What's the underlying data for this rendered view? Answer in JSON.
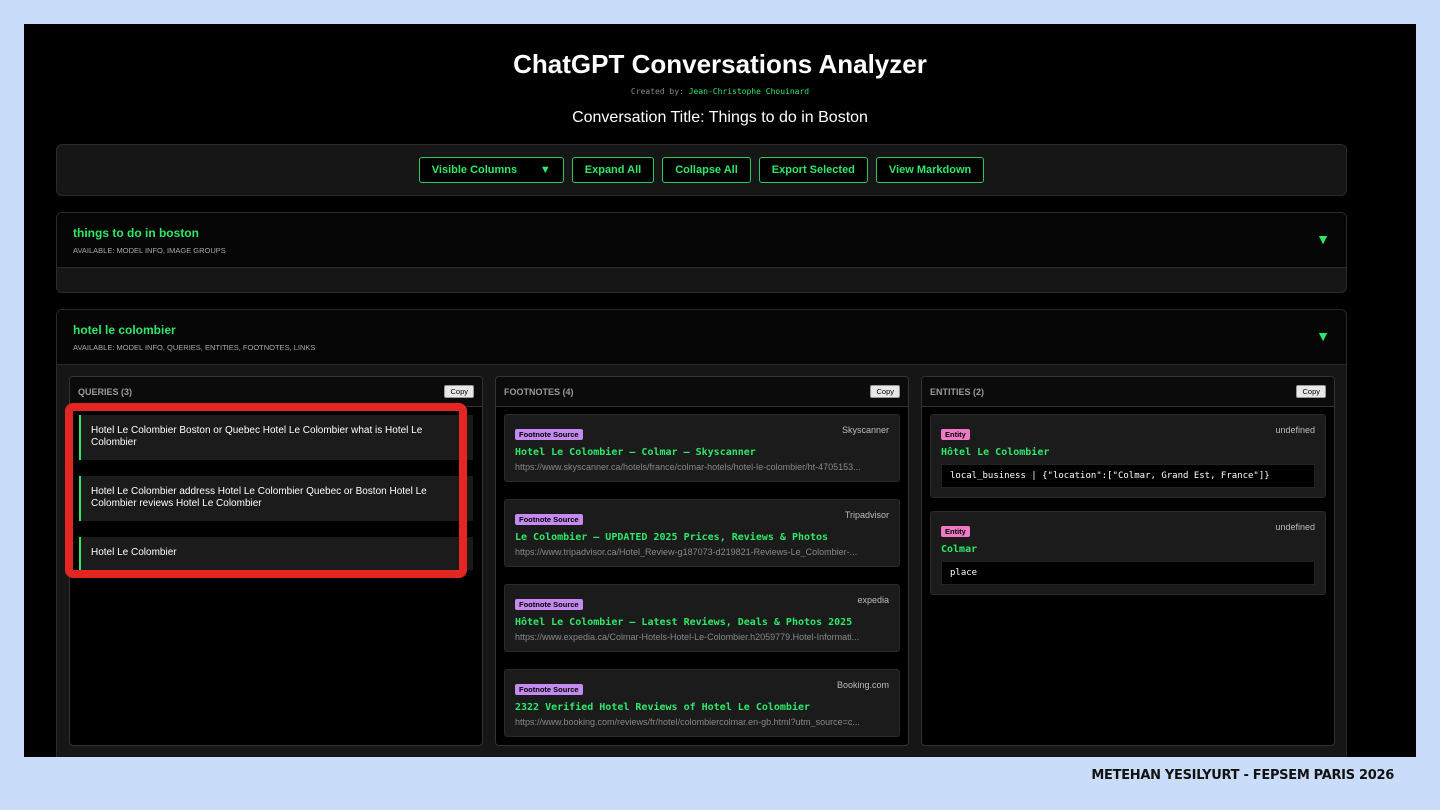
{
  "app": {
    "title": "ChatGPT Conversations Analyzer",
    "created_label": "Created by:",
    "author": "Jean-Christophe Chouinard",
    "conversation_title": "Conversation Title: Things to do in Boston"
  },
  "toolbar": {
    "visible_columns": "Visible Columns",
    "dropdown_arrow": "▼",
    "expand_all": "Expand All",
    "collapse_all": "Collapse All",
    "export_selected": "Export Selected",
    "view_markdown": "View Markdown"
  },
  "panels": [
    {
      "name": "things to do in boston",
      "available": "AVAILABLE: MODEL INFO, IMAGE GROUPS",
      "toggle": "▼"
    },
    {
      "name": "hotel le colombier",
      "available": "AVAILABLE: MODEL INFO, QUERIES, ENTITIES, FOOTNOTES, LINKS",
      "toggle": "▼"
    }
  ],
  "queries": {
    "title": "QUERIES (3)",
    "copy": "Copy",
    "items": [
      "Hotel Le Colombier Boston or Quebec Hotel Le Colombier what is Hotel Le Colombier",
      "Hotel Le Colombier address Hotel Le Colombier Quebec or Boston Hotel Le Colombier reviews Hotel Le Colombier",
      "Hotel Le Colombier"
    ]
  },
  "footnotes": {
    "title": "FOOTNOTES (4)",
    "copy": "Copy",
    "items": [
      {
        "badge": "Footnote Source",
        "site": "Skyscanner",
        "title": "Hotel Le Colombier – Colmar – Skyscanner",
        "url": "https://www.skyscanner.ca/hotels/france/colmar-hotels/hotel-le-colombier/ht-4705153..."
      },
      {
        "badge": "Footnote Source",
        "site": "Tripadvisor",
        "title": "Le Colombier – UPDATED 2025 Prices, Reviews & Photos",
        "url": "https://www.tripadvisor.ca/Hotel_Review-g187073-d219821-Reviews-Le_Colombier-..."
      },
      {
        "badge": "Footnote Source",
        "site": "expedia",
        "title": "Hôtel Le Colombier – Latest Reviews, Deals & Photos 2025",
        "url": "https://www.expedia.ca/Colmar-Hotels-Hotel-Le-Colombier.h2059779.Hotel-Informati..."
      },
      {
        "badge": "Footnote Source",
        "site": "Booking.com",
        "title": "2322 Verified Hotel Reviews of Hotel Le Colombier",
        "url": "https://www.booking.com/reviews/fr/hotel/colombiercolmar.en-gb.html?utm_source=c..."
      }
    ]
  },
  "entities": {
    "title": "ENTITIES (2)",
    "copy": "Copy",
    "items": [
      {
        "badge": "Entity",
        "type": "undefined",
        "name": "Hôtel Le Colombier",
        "value": "local_business | {\"location\":[\"Colmar, Grand Est, France\"]}"
      },
      {
        "badge": "Entity",
        "type": "undefined",
        "name": "Colmar",
        "value": "place"
      }
    ]
  },
  "footer": {
    "credit": "METEHAN YESILYURT - FEPSEM PARIS 2026"
  },
  "colors": {
    "accent": "#2ee86a",
    "highlight": "#e32621",
    "footnote_badge": "#c48af0",
    "entity_badge": "#f07ac4",
    "background": "#c9dcfa"
  }
}
